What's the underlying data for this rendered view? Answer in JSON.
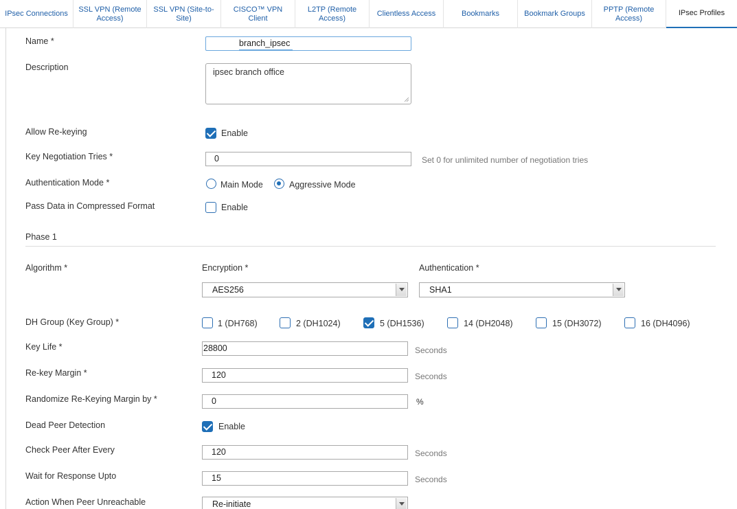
{
  "tabs": [
    {
      "label": "IPsec Connections",
      "active": false
    },
    {
      "label": "SSL VPN (Remote Access)",
      "active": false
    },
    {
      "label": "SSL VPN (Site-to-Site)",
      "active": false
    },
    {
      "label": "CISCO™ VPN Client",
      "active": false
    },
    {
      "label": "L2TP (Remote Access)",
      "active": false
    },
    {
      "label": "Clientless Access",
      "active": false
    },
    {
      "label": "Bookmarks",
      "active": false
    },
    {
      "label": "Bookmark Groups",
      "active": false
    },
    {
      "label": "PPTP (Remote Access)",
      "active": false
    },
    {
      "label": "IPsec Profiles",
      "active": true
    }
  ],
  "form": {
    "name": {
      "label": "Name *",
      "value": "branch_ipsec"
    },
    "description": {
      "label": "Description",
      "value": "ipsec branch office"
    },
    "allow_rekeying": {
      "label": "Allow Re-keying",
      "option": "Enable",
      "checked": true
    },
    "key_negotiation": {
      "label": "Key Negotiation Tries *",
      "value": "0",
      "hint": "Set 0 for unlimited number of negotiation tries"
    },
    "auth_mode": {
      "label": "Authentication Mode *",
      "options": [
        "Main Mode",
        "Aggressive Mode"
      ],
      "selected": "Aggressive Mode"
    },
    "compressed": {
      "label": "Pass Data in Compressed Format",
      "option": "Enable",
      "checked": false
    }
  },
  "phase1": {
    "title": "Phase 1",
    "algorithm_label": "Algorithm *",
    "encryption": {
      "label": "Encryption *",
      "value": "AES256"
    },
    "authentication": {
      "label": "Authentication *",
      "value": "SHA1"
    },
    "dh_group": {
      "label": "DH Group (Key Group) *",
      "options": [
        {
          "label": "1 (DH768)",
          "checked": false
        },
        {
          "label": "2 (DH1024)",
          "checked": false
        },
        {
          "label": "5 (DH1536)",
          "checked": true
        },
        {
          "label": "14 (DH2048)",
          "checked": false
        },
        {
          "label": "15 (DH3072)",
          "checked": false
        },
        {
          "label": "16 (DH4096)",
          "checked": false
        }
      ]
    },
    "key_life": {
      "label": "Key Life *",
      "value": "28800",
      "unit": "Seconds"
    },
    "rekey_margin": {
      "label": "Re-key Margin *",
      "value": "120",
      "unit": "Seconds"
    },
    "randomize": {
      "label": "Randomize Re-Keying Margin by *",
      "value": "0",
      "unit": "%"
    },
    "dpd": {
      "label": "Dead Peer Detection",
      "option": "Enable",
      "checked": true
    },
    "check_peer": {
      "label": "Check Peer After Every",
      "value": "120",
      "unit": "Seconds"
    },
    "wait_response": {
      "label": "Wait for Response Upto",
      "value": "15",
      "unit": "Seconds"
    },
    "action_unreachable": {
      "label": "Action When Peer Unreachable",
      "value": "Re-initiate"
    }
  },
  "colors": {
    "accent": "#1f6fb7",
    "tab_link": "#1f5fa8",
    "border": "#a9a9a9"
  }
}
